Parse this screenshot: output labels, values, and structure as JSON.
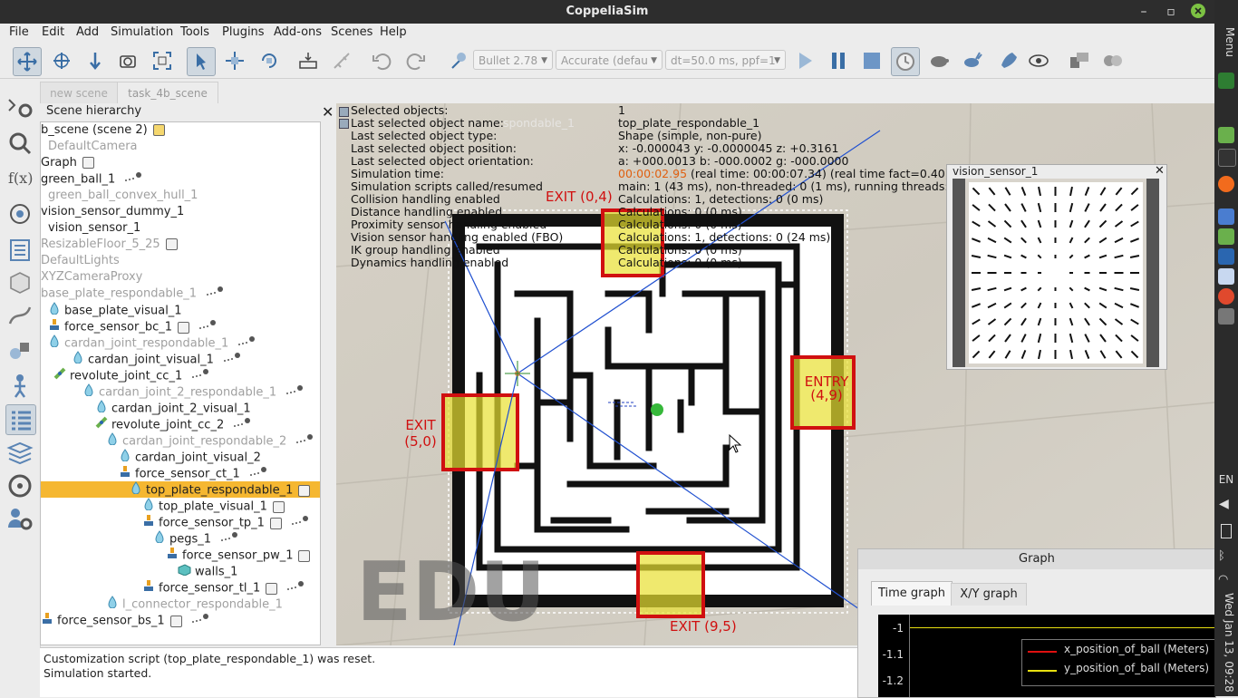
{
  "app": {
    "title": "CoppeliaSim"
  },
  "menu": [
    "File",
    "Edit",
    "Add",
    "Simulation",
    "Tools",
    "Plugins",
    "Add-ons",
    "Scenes",
    "Help"
  ],
  "toolbar": {
    "engine": "Bullet 2.78",
    "accuracy": "Accurate (defau",
    "timestep": "dt=50.0 ms, ppf=1"
  },
  "tabs": [
    "new scene",
    "task_4b_scene"
  ],
  "hierarchy": {
    "title": "Scene hierarchy",
    "rows": [
      {
        "label": "b_scene (scene 2)",
        "dim": false
      },
      {
        "label": "DefaultCamera",
        "dim": true
      },
      {
        "label": "Graph",
        "dim": false
      },
      {
        "label": "green_ball_1",
        "dim": false
      },
      {
        "label": "green_ball_convex_hull_1",
        "dim": true
      },
      {
        "label": "vision_sensor_dummy_1",
        "dim": false
      },
      {
        "label": "vision_sensor_1",
        "dim": false
      },
      {
        "label": "ResizableFloor_5_25",
        "dim": true
      },
      {
        "label": "DefaultLights",
        "dim": true
      },
      {
        "label": "XYZCameraProxy",
        "dim": true
      },
      {
        "label": "base_plate_respondable_1",
        "dim": true
      },
      {
        "label": "base_plate_visual_1",
        "dim": false
      },
      {
        "label": "force_sensor_bc_1",
        "dim": false
      },
      {
        "label": "cardan_joint_respondable_1",
        "dim": true
      },
      {
        "label": "cardan_joint_visual_1",
        "dim": false
      },
      {
        "label": "revolute_joint_cc_1",
        "dim": false
      },
      {
        "label": "cardan_joint_2_respondable_1",
        "dim": true
      },
      {
        "label": "cardan_joint_2_visual_1",
        "dim": false
      },
      {
        "label": "revolute_joint_cc_2",
        "dim": false
      },
      {
        "label": "cardan_joint_respondable_2",
        "dim": true
      },
      {
        "label": "cardan_joint_visual_2",
        "dim": false
      },
      {
        "label": "force_sensor_ct_1",
        "dim": false
      },
      {
        "label": "top_plate_respondable_1",
        "dim": false
      },
      {
        "label": "top_plate_visual_1",
        "dim": false
      },
      {
        "label": "force_sensor_tp_1",
        "dim": false
      },
      {
        "label": "pegs_1",
        "dim": false
      },
      {
        "label": "force_sensor_pw_1",
        "dim": false
      },
      {
        "label": "walls_1",
        "dim": false
      },
      {
        "label": "force_sensor_tl_1",
        "dim": false
      },
      {
        "label": "l_connector_respondable_1",
        "dim": true
      },
      {
        "label": "force_sensor_bs_1",
        "dim": false
      }
    ]
  },
  "info": {
    "labels": [
      "Selected objects:",
      "Last selected object name:",
      "Last selected object type:",
      "Last selected object position:",
      "Last selected object orientation:",
      "Simulation time:",
      "Simulation scripts called/resumed",
      "Collision handling enabled",
      "Distance handling enabled",
      "Proximity sensor handling enabled",
      "Vision sensor handling enabled (FBO)",
      "IK group handling enabled",
      "Dynamics handling enabled"
    ],
    "values": [
      "1",
      "top_plate_respondable_1",
      "Shape (simple, non-pure)",
      "x: -0.000043   y: -0.0000045   z: +0.3161",
      "a: +000.0013    b: -000.0002    g: -000.0000",
      "",
      "main: 1 (43 ms), non-threaded: 0 (1 ms), running threads: 0 (0 ms)",
      "Calculations: 1, detections: 0 (0 ms)",
      "Calculations: 0 (0 ms)",
      "Calculations: 0 (0 ms)",
      "Calculations: 1, detections: 0 (24 ms)",
      "Calculations: 0 (0 ms)",
      "Calculations: 0 (0 ms)"
    ],
    "sim_time": "00:00:02.95",
    "sim_time_rest": " (real time: 00:00:07.34) (real time fact=0.40) (dt=50.0 ms)",
    "ghost_name": "spondable_1"
  },
  "maze_labels": {
    "exit_top": "EXIT (0,4)",
    "exit_left_1": "EXIT",
    "exit_left_2": "(5,0)",
    "entry_1": "ENTRY",
    "entry_2": "(4,9)",
    "exit_bottom": "EXIT (9,5)",
    "watermark": "EDU"
  },
  "vision": {
    "title": "vision_sensor_1"
  },
  "graph": {
    "title": "Graph",
    "tabs": [
      "Time graph",
      "X/Y graph"
    ],
    "y_ticks": [
      "-1",
      "-1.1",
      "-1.2"
    ],
    "legend": [
      "x_position_of_ball (Meters)",
      "y_position_of_ball (Meters)"
    ],
    "colors": {
      "x": "#e01010",
      "y": "#e8e010"
    }
  },
  "console": [
    "Customization script (top_plate_respondable_1) was reset.",
    "Simulation started."
  ],
  "system": {
    "date": "Wed Jan 13, 09:28",
    "lang": "EN"
  },
  "colors": {
    "accent": "#f5b731",
    "exit_red": "#d01010",
    "title_bg": "#2d2d2d"
  }
}
